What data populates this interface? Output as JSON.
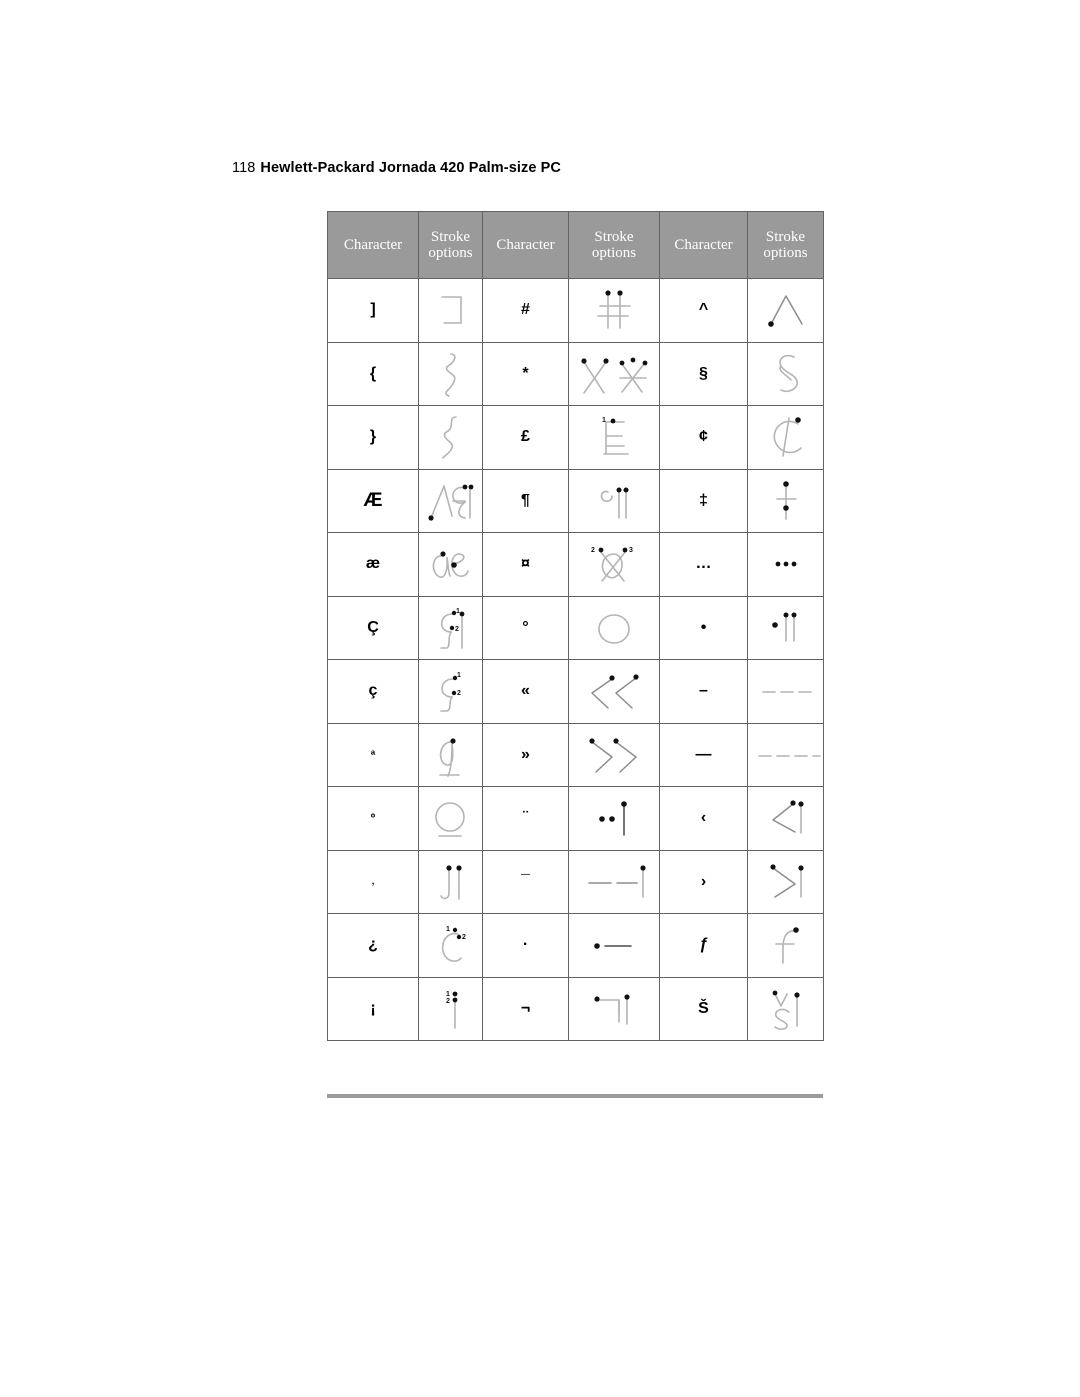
{
  "page": {
    "folio": "118",
    "header_title": "Hewlett-Packard Jornada 420 Palm-size PC"
  },
  "table": {
    "headers": {
      "character": "Character",
      "stroke_line1": "Stroke",
      "stroke_line2": "options"
    },
    "column_headers": [
      "Character",
      "Stroke options",
      "Character",
      "Stroke options",
      "Character",
      "Stroke options"
    ],
    "rows": [
      {
        "pairs": [
          {
            "character": "]",
            "stroke": "bracket-right-stroke"
          },
          {
            "character": "#",
            "stroke": "hash-two-dots-stroke"
          },
          {
            "character": "^",
            "stroke": "caret-dot-stroke"
          }
        ]
      },
      {
        "pairs": [
          {
            "character": "{",
            "stroke": "brace-left-stroke"
          },
          {
            "character": "*",
            "stroke": "asterisk-cross-stroke"
          },
          {
            "character": "§",
            "stroke": "section-sign-stroke"
          }
        ]
      },
      {
        "pairs": [
          {
            "character": "}",
            "stroke": "brace-right-stroke"
          },
          {
            "character": "£",
            "stroke": "pound-ladder-stroke"
          },
          {
            "character": "¢",
            "stroke": "cent-sign-stroke"
          }
        ]
      },
      {
        "pairs": [
          {
            "character": "Æ",
            "stroke": "ae-ligature-capital-stroke"
          },
          {
            "character": "¶",
            "stroke": "pilcrow-stroke"
          },
          {
            "character": "‡",
            "stroke": "double-dagger-stroke"
          }
        ]
      },
      {
        "pairs": [
          {
            "character": "æ",
            "stroke": "ae-ligature-small-stroke"
          },
          {
            "character": "¤",
            "stroke": "currency-crossed-circle-stroke"
          },
          {
            "character": "…",
            "stroke": "ellipsis-stroke"
          }
        ]
      },
      {
        "pairs": [
          {
            "character": "Ç",
            "stroke": "c-cedilla-capital-stroke"
          },
          {
            "character": "°",
            "stroke": "degree-circle-stroke"
          },
          {
            "character": "•",
            "stroke": "bullet-two-bars-stroke"
          }
        ]
      },
      {
        "pairs": [
          {
            "character": "ç",
            "stroke": "c-cedilla-small-stroke"
          },
          {
            "character": "«",
            "stroke": "double-left-angle-stroke"
          },
          {
            "character": "–",
            "stroke": "en-dash-stroke"
          }
        ]
      },
      {
        "pairs": [
          {
            "character": "ª",
            "stroke": "ordinal-a-stroke"
          },
          {
            "character": "»",
            "stroke": "double-right-angle-stroke"
          },
          {
            "character": "—",
            "stroke": "em-dash-stroke"
          }
        ]
      },
      {
        "pairs": [
          {
            "character": "º",
            "stroke": "ordinal-o-stroke"
          },
          {
            "character": "¨",
            "stroke": "diaeresis-two-dots-stroke"
          },
          {
            "character": "‹",
            "stroke": "single-left-angle-stroke"
          }
        ]
      },
      {
        "pairs": [
          {
            "character": "‚",
            "stroke": "low-quote-stroke"
          },
          {
            "character": "¯",
            "stroke": "macron-bars-stroke"
          },
          {
            "character": "›",
            "stroke": "single-right-angle-stroke"
          }
        ]
      },
      {
        "pairs": [
          {
            "character": "¿",
            "stroke": "inverted-question-stroke"
          },
          {
            "character": "·",
            "stroke": "middle-dot-bar-stroke"
          },
          {
            "character": "ƒ",
            "stroke": "florin-hook-stroke"
          }
        ]
      },
      {
        "pairs": [
          {
            "character": "¡",
            "stroke": "inverted-exclamation-stroke"
          },
          {
            "character": "¬",
            "stroke": "not-sign-stroke"
          },
          {
            "character": "Š",
            "stroke": "s-caron-stroke"
          }
        ]
      }
    ]
  },
  "colors": {
    "header_background": "#9a9a9a",
    "header_text": "#ffffff",
    "table_border": "#636363",
    "stroke_light": "#b4b4b4",
    "stroke_dark": "#4a4a4a",
    "dot": "#111111",
    "footer_rule": "#9a9a9a",
    "page_background": "#ffffff"
  }
}
